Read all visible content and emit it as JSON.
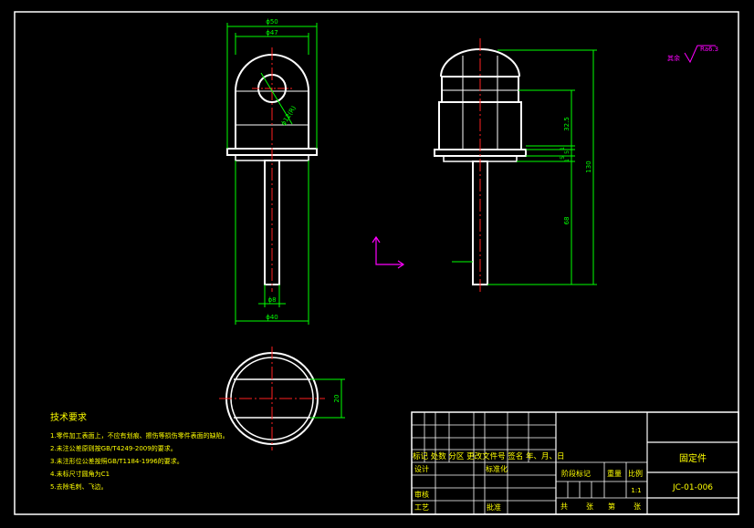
{
  "colors": {
    "background": "#000000",
    "outline": "#ffffff",
    "dimension": "#00ff00",
    "centerline": "#ff2020",
    "notes": "#ffff00",
    "axis_marker": "#ff00ff"
  },
  "dimensions": {
    "overall_width": "ϕ50",
    "inner_width": "ϕ47",
    "hole_radius": "ϕ12(R)",
    "stem_diameter": "ϕ8",
    "base_diameter": "ϕ40",
    "head_height": "32.5",
    "flange_1": "1",
    "flange_2": "5",
    "flange_3": "5",
    "flange_4": "1",
    "stem_length": "68",
    "total_height": "130",
    "slot_width": "20"
  },
  "surface_finish": {
    "label": "其余",
    "value": "Ra6.3"
  },
  "tech_requirements": {
    "title": "技术要求",
    "items": [
      "1.零件加工表面上，不应有划痕、擦伤等损伤零件表面的缺陷。",
      "2.未注公差原则按GB/T4249-2009的要求。",
      "3.未注形位公差按照GB/T1184-1996的要求。",
      "4.未标尺寸圆角为C1",
      "5.去除毛刺、飞边。"
    ]
  },
  "title_block": {
    "revision_header": "标记 处数  分区 更改文件号  签名  年、月、日",
    "design": "设计",
    "standardize": "标准化",
    "review": "审核",
    "process": "工艺",
    "approve": "批准",
    "stage_mark": "阶段标记",
    "weight": "重量",
    "scale": "比例",
    "scale_value": "1:1",
    "total": "共",
    "sheets": "张",
    "page": "第",
    "page_sheets": "张",
    "part_name": "固定件",
    "drawing_number": "JC-01-006"
  }
}
